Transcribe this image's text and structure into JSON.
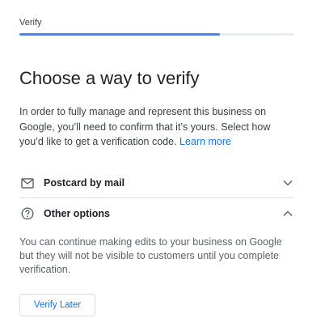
{
  "header": {
    "title": "Verify"
  },
  "progress": {
    "fraction": 0.73
  },
  "main": {
    "heading": "Choose a way to verify",
    "description": "In order to fully manage and represent this business on Google, you’ll need to confirm that it’s yours. Select how you’d like to get a verification code.",
    "learn_more": "Learn more"
  },
  "options": [
    {
      "label": "Postcard by mail",
      "icon": "mail-icon",
      "expanded": false
    },
    {
      "label": "Other options",
      "icon": "help-circle-icon",
      "expanded": true
    }
  ],
  "other_options": {
    "text": "You can continue making edits to your business on Google but they will not be visible to customers until you complete verification.",
    "button_label": "Verify Later"
  },
  "colors": {
    "accent": "#4285f4",
    "link": "#1a73e8"
  }
}
